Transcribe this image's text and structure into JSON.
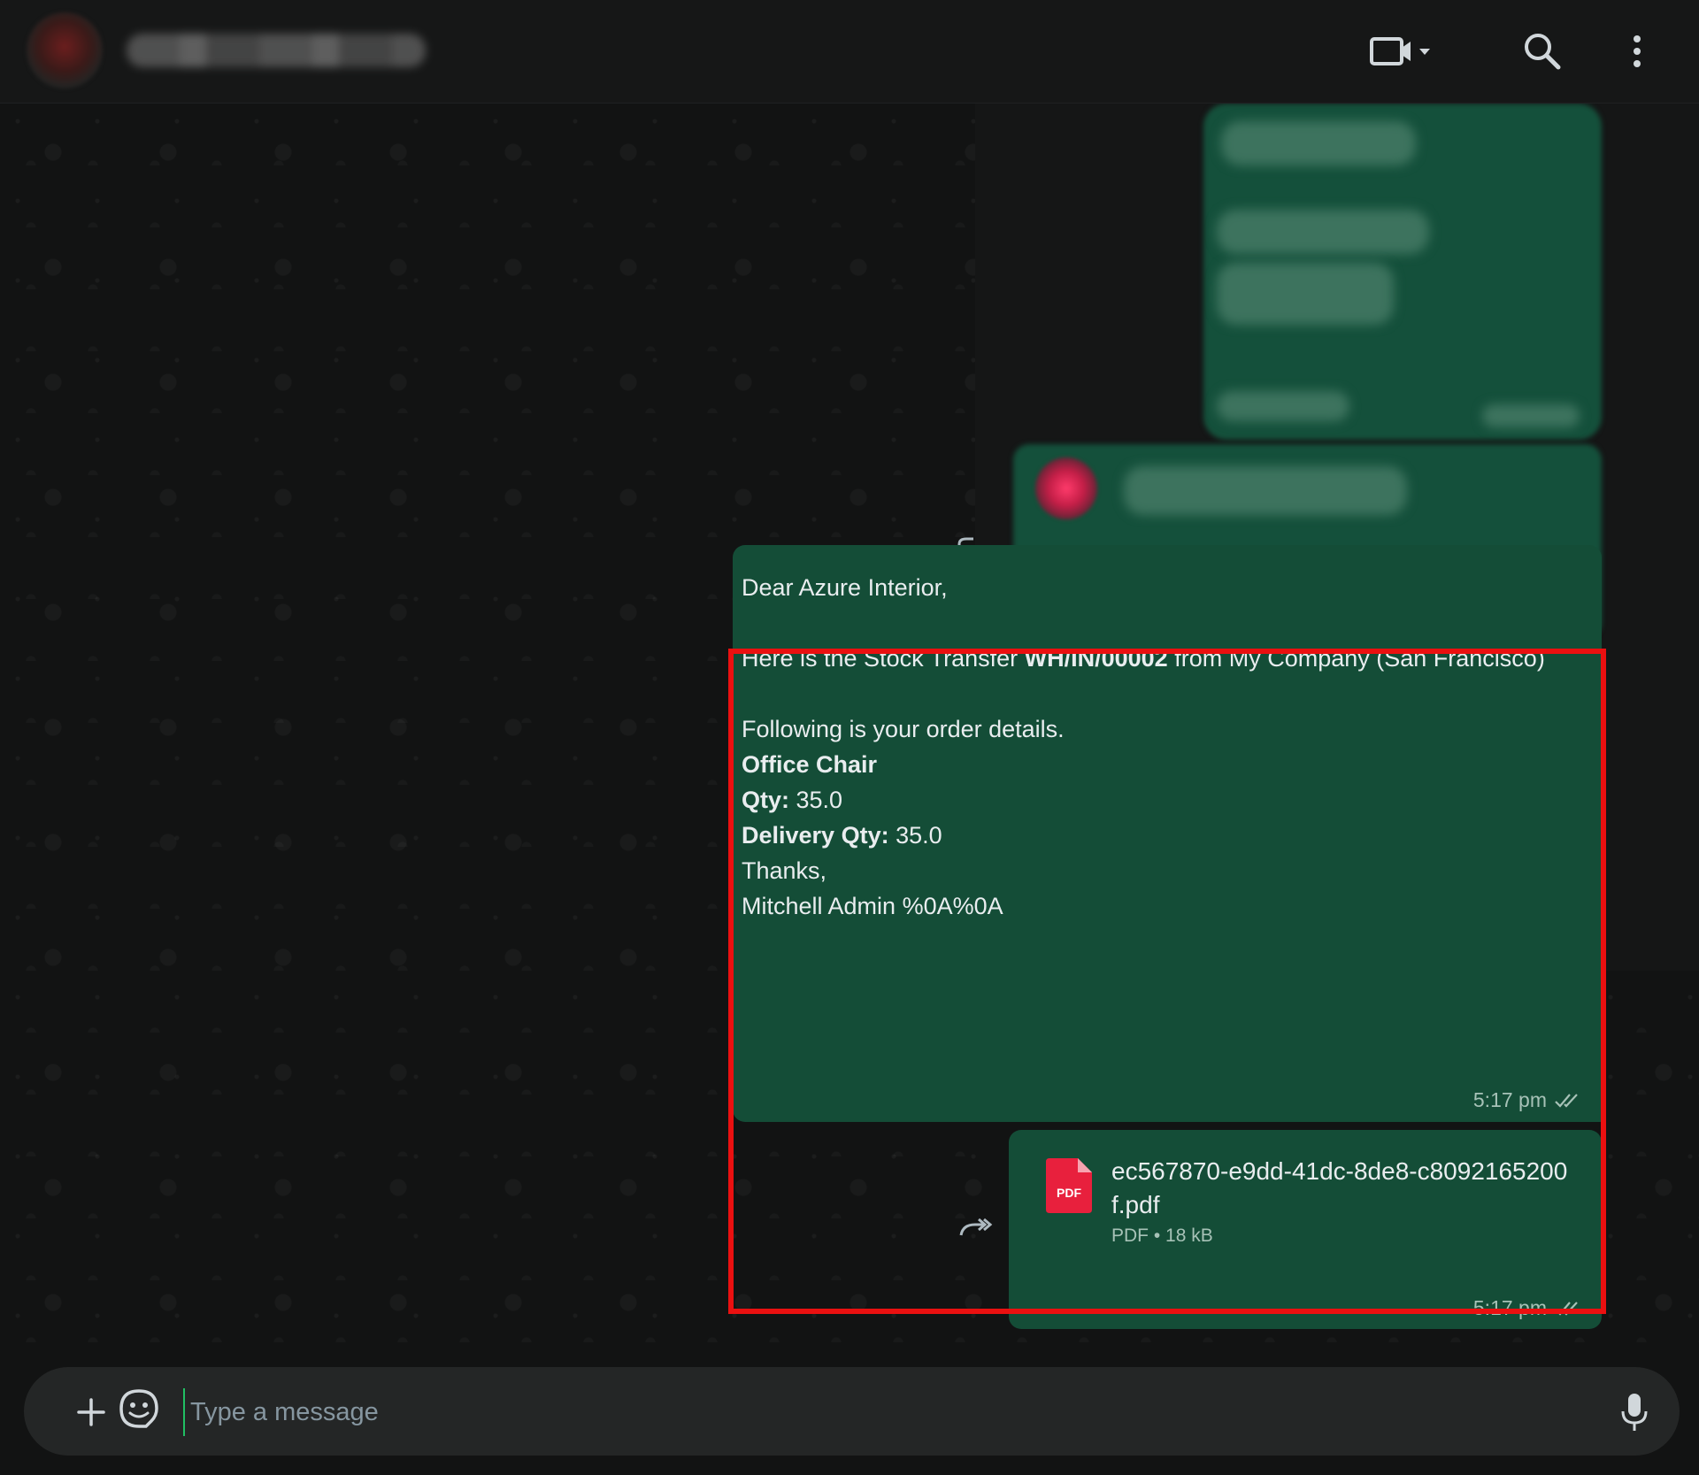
{
  "header": {
    "contact_name": "",
    "icons": [
      "video-call-icon",
      "chevron-down-icon",
      "search-icon",
      "more-vert-icon"
    ]
  },
  "message": {
    "greeting": "Dear Azure Interior,",
    "intro_pre": "Here is the Stock Transfer ",
    "intro_ref": "WH/IN/00002",
    "intro_post": " from My Company (San Francisco)",
    "details_line": "Following is your order details.",
    "product": "Office Chair",
    "qty_label": "Qty:",
    "qty_value": " 35.0",
    "delivery_label": "Delivery Qty:",
    "delivery_value": " 35.0",
    "thanks": "Thanks,",
    "signature": "Mitchell Admin %0A%0A",
    "time": "5:17 pm"
  },
  "attachment": {
    "file_name": "ec567870-e9dd-41dc-8de8-c8092165200f.pdf",
    "file_type": "PDF",
    "file_size": "18 kB",
    "separator": "•",
    "icon_label": "PDF",
    "time": "5:17 pm"
  },
  "composer": {
    "placeholder": "Type a message"
  },
  "colors": {
    "bubble": "#144d37",
    "highlight": "#ea1010",
    "background": "#161717"
  }
}
